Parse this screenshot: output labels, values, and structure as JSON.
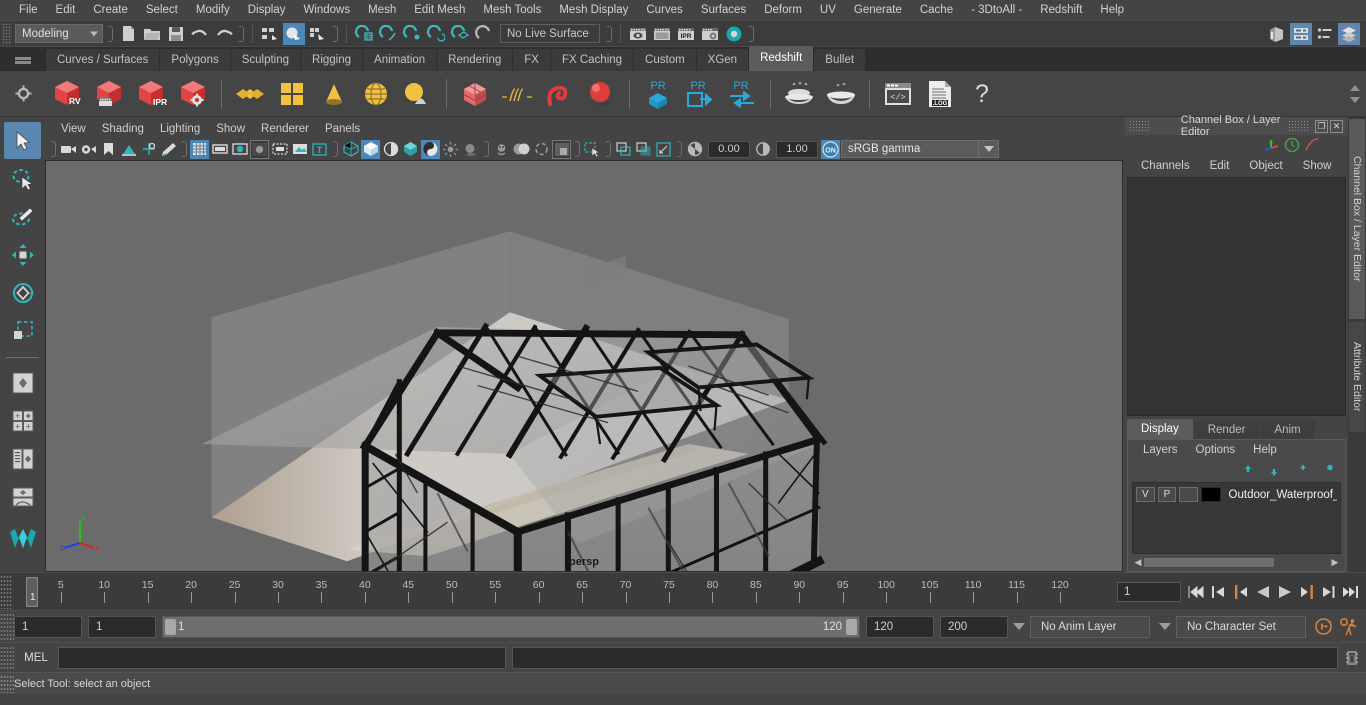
{
  "menubar": {
    "items": [
      "File",
      "Edit",
      "Create",
      "Select",
      "Modify",
      "Display",
      "Windows",
      "Mesh",
      "Edit Mesh",
      "Mesh Tools",
      "Mesh Display",
      "Curves",
      "Surfaces",
      "Deform",
      "UV",
      "Generate",
      "Cache",
      "- 3DtoAll -",
      "Redshift",
      "Help"
    ]
  },
  "statusline": {
    "menuset": "Modeling",
    "live_surface": "No Live Surface"
  },
  "shelf": {
    "tabs": [
      "Curves / Surfaces",
      "Polygons",
      "Sculpting",
      "Rigging",
      "Animation",
      "Rendering",
      "FX",
      "FX Caching",
      "Custom",
      "XGen",
      "Redshift",
      "Bullet"
    ],
    "selected_tab": "Redshift",
    "icon_labels": [
      "RV",
      "IPR",
      "PR",
      "PR",
      "PR",
      ".LOG"
    ]
  },
  "viewport": {
    "panel_menu": [
      "View",
      "Shading",
      "Lighting",
      "Show",
      "Renderer",
      "Panels"
    ],
    "exposure": "0.00",
    "gamma": "1.00",
    "color_space": "sRGB gamma",
    "camera_label": "persp",
    "axis_x": "x",
    "axis_y": "y",
    "axis_z": "z"
  },
  "channelbox": {
    "title": "Channel Box / Layer Editor",
    "menu": [
      "Channels",
      "Edit",
      "Object",
      "Show"
    ]
  },
  "layer_editor": {
    "tabs": [
      "Display",
      "Render",
      "Anim"
    ],
    "selected_tab": "Display",
    "menu": [
      "Layers",
      "Options",
      "Help"
    ],
    "layers": [
      {
        "visible": "V",
        "playback": "P",
        "shading": "",
        "color": "#000000",
        "name": "Outdoor_Waterproof_"
      }
    ]
  },
  "dock_tabs": {
    "items": [
      "Channel Box / Layer Editor",
      "Attribute Editor"
    ],
    "selected": "Channel Box / Layer Editor"
  },
  "timeslider": {
    "current_frame_marker": "1",
    "current_frame_field": "1",
    "tick_labels": [
      5,
      10,
      15,
      20,
      25,
      30,
      35,
      40,
      45,
      50,
      55,
      60,
      65,
      70,
      75,
      80,
      85,
      90,
      95,
      100,
      105,
      110,
      115,
      120
    ],
    "range_start": 1,
    "range_end": 120
  },
  "rangerow": {
    "anim_start": "1",
    "playback_start": "1",
    "slider_low": "1",
    "slider_high": "120",
    "playback_end": "120",
    "anim_end": "200",
    "anim_layer": "No Anim Layer",
    "character_set": "No Character Set"
  },
  "commandline": {
    "language": "MEL",
    "input_value": "",
    "output_value": ""
  },
  "helpline": {
    "message": "Select Tool: select an object"
  },
  "colors": {
    "accent_blue": "#4b87b8",
    "teal": "#1aa8b0",
    "orange": "#d4803c",
    "redshift_red": "#e03c3c",
    "shelf_yellow": "#f0c040"
  }
}
